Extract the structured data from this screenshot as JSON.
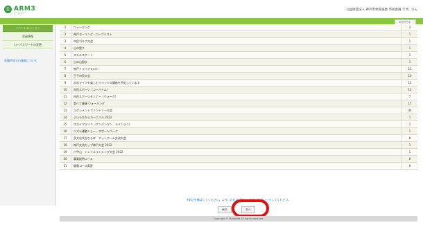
{
  "header": {
    "logo_mark": "①",
    "logo_text": "ARM3",
    "logo_sub": "エームスリー",
    "org_line": "公益財団法人 神戸市体育協会 市民会員 です。さん"
  },
  "toolbar": {
    "logout_label": "ログアウト"
  },
  "sidebar": {
    "items": [
      {
        "label": "イベントエントリー"
      },
      {
        "label": "会員情報"
      },
      {
        "label": "ローパスワードの変更"
      }
    ],
    "link_label": "各種手続きの業務について"
  },
  "table": {
    "rows": [
      {
        "num": "1",
        "name": "ウォーキング",
        "count": "3"
      },
      {
        "num": "2",
        "name": "神戸セーリング・ロープテスト",
        "count": "1"
      },
      {
        "num": "3",
        "name": "市民ゴルフ大会",
        "count": "1"
      },
      {
        "num": "4",
        "name": "山市登り",
        "count": "1"
      },
      {
        "num": "5",
        "name": "スキルスケート",
        "count": "1"
      },
      {
        "num": "6",
        "name": "山の山脈歩",
        "count": "1"
      },
      {
        "num": "7",
        "name": "神戸トライアスロン",
        "count": "11"
      },
      {
        "num": "8",
        "name": "王子市民大会",
        "count": "10"
      },
      {
        "num": "9",
        "name": "水泳ライフを楽しむリラックス講座を予定しています",
        "count": "12"
      },
      {
        "num": "10",
        "name": "市民スポーツ（コーバイム）",
        "count": "12"
      },
      {
        "num": "11",
        "name": "市民スポーツセミナー（ウォーク）",
        "count": "7"
      },
      {
        "num": "12",
        "name": "食べて健康 ウォーキング",
        "count": "17"
      },
      {
        "num": "13",
        "name": "コグレメントファントリー大会",
        "count": "34"
      },
      {
        "num": "14",
        "name": "よいもちからカーニバル 2022",
        "count": "1"
      },
      {
        "num": "15",
        "name": "スカイマラソン（アンパンマン　ラインラン）",
        "count": "1"
      },
      {
        "num": "16",
        "name": "リズム運動ショー・スポーツパーク",
        "count": "1"
      },
      {
        "num": "17",
        "name": "多文化共生ひろば　アットホーム交流大会",
        "count": "8"
      },
      {
        "num": "18",
        "name": "神戸交流カップ神戸大会 2022",
        "count": "1"
      },
      {
        "num": "19",
        "name": "六甲山　トレイルランニング大会 2022",
        "count": "1"
      },
      {
        "num": "20",
        "name": "事業説明コース",
        "count": "0"
      },
      {
        "num": "21",
        "name": "健康コース実習",
        "count": "0"
      }
    ]
  },
  "notice_text": "※申込を確認してください。よろしければ「次へ」ボタンをクリックしてください。",
  "buttons": {
    "back_label": "戻る",
    "next_label": "次へ"
  },
  "footer_text": "Copyright © ManaNet-All rights reserved."
}
